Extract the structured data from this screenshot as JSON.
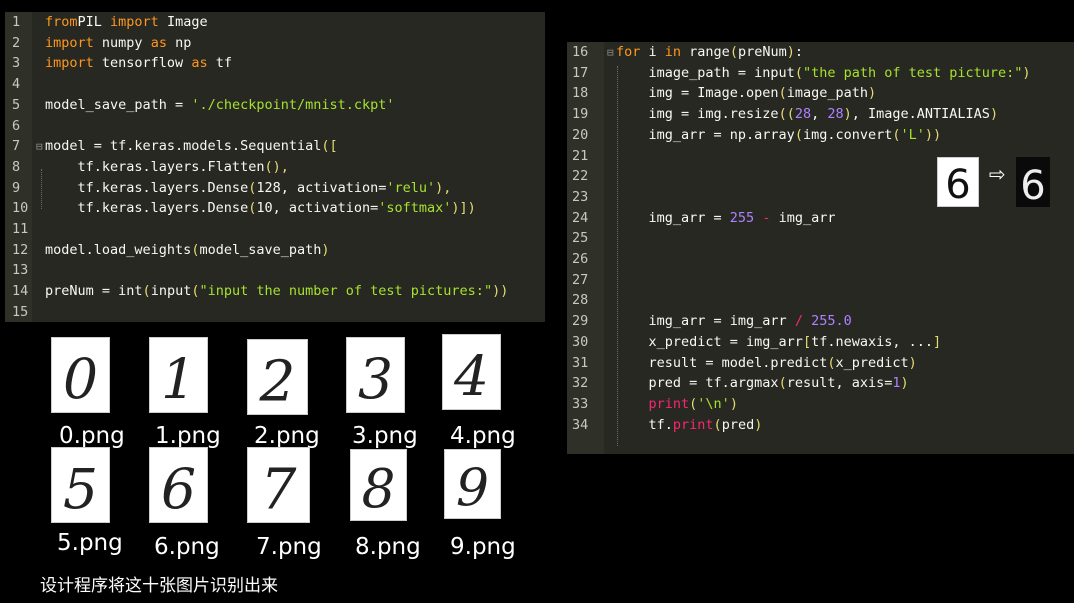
{
  "left_editor": {
    "lines": [
      {
        "n": "1",
        "parts": [
          [
            "kw2",
            "from"
          ],
          [
            "",
            "PIL "
          ],
          [
            "kw2",
            "import"
          ],
          [
            "",
            " Image"
          ]
        ]
      },
      {
        "n": "2",
        "parts": [
          [
            "kw2",
            "import"
          ],
          [
            "",
            " numpy "
          ],
          [
            "kw2",
            "as"
          ],
          [
            "",
            " np"
          ]
        ]
      },
      {
        "n": "3",
        "parts": [
          [
            "kw2",
            "import"
          ],
          [
            "",
            " tensorflow "
          ],
          [
            "kw2",
            "as"
          ],
          [
            "",
            " tf"
          ]
        ]
      },
      {
        "n": "4",
        "parts": []
      },
      {
        "n": "5",
        "parts": [
          [
            "",
            "model_save_path = "
          ],
          [
            "str",
            "'./checkpoint/mnist.ckpt'"
          ]
        ]
      },
      {
        "n": "6",
        "parts": []
      },
      {
        "n": "7",
        "parts": [
          [
            "",
            "model = tf.keras.models.Sequential"
          ],
          [
            "pn",
            "(["
          ]
        ]
      },
      {
        "n": "8",
        "parts": [
          [
            "",
            "    tf.keras.layers.Flatten"
          ],
          [
            "pn",
            "(),"
          ]
        ]
      },
      {
        "n": "9",
        "parts": [
          [
            "",
            "    tf.keras.layers.Dense"
          ],
          [
            "pn",
            "("
          ],
          [
            "",
            "128, activation="
          ],
          [
            "str",
            "'relu'"
          ],
          [
            "pn",
            "),"
          ]
        ]
      },
      {
        "n": "10",
        "parts": [
          [
            "",
            "    tf.keras.layers.Dense"
          ],
          [
            "pn",
            "("
          ],
          [
            "",
            "10, activation="
          ],
          [
            "str",
            "'softmax'"
          ],
          [
            "pn",
            ")])"
          ]
        ]
      },
      {
        "n": "11",
        "parts": []
      },
      {
        "n": "12",
        "parts": [
          [
            "",
            "model.load_weights"
          ],
          [
            "pn",
            "("
          ],
          [
            "",
            "model_save_path"
          ],
          [
            "pn",
            ")"
          ]
        ]
      },
      {
        "n": "13",
        "parts": []
      },
      {
        "n": "14",
        "parts": [
          [
            "",
            "preNum = int"
          ],
          [
            "pn",
            "("
          ],
          [
            "",
            "input"
          ],
          [
            "pn",
            "("
          ],
          [
            "str",
            "\"input the number of test pictures:\""
          ],
          [
            "pn",
            "))"
          ]
        ]
      },
      {
        "n": "15",
        "parts": []
      }
    ]
  },
  "right_editor": {
    "lines": [
      {
        "n": "16",
        "parts": [
          [
            "kw2",
            "for"
          ],
          [
            "",
            " i "
          ],
          [
            "kw2",
            "in"
          ],
          [
            "",
            " range"
          ],
          [
            "pn",
            "("
          ],
          [
            "",
            "preNum"
          ],
          [
            "pn",
            ")"
          ],
          [
            "",
            ":"
          ]
        ]
      },
      {
        "n": "17",
        "parts": [
          [
            "",
            "    image_path = input"
          ],
          [
            "pn",
            "("
          ],
          [
            "str",
            "\"the path of test picture:\""
          ],
          [
            "pn",
            ")"
          ]
        ]
      },
      {
        "n": "18",
        "parts": [
          [
            "",
            "    img = Image.open"
          ],
          [
            "pn",
            "("
          ],
          [
            "",
            "image_path"
          ],
          [
            "pn",
            ")"
          ]
        ]
      },
      {
        "n": "19",
        "parts": [
          [
            "",
            "    img = img.resize"
          ],
          [
            "pn",
            "(("
          ],
          [
            "num",
            "28"
          ],
          [
            "",
            ", "
          ],
          [
            "num",
            "28"
          ],
          [
            "pn",
            ")"
          ],
          [
            "",
            ", Image.ANTIALIAS"
          ],
          [
            "pn",
            ")"
          ]
        ]
      },
      {
        "n": "20",
        "parts": [
          [
            "",
            "    img_arr = np.array"
          ],
          [
            "pn",
            "("
          ],
          [
            "",
            "img.convert"
          ],
          [
            "pn",
            "("
          ],
          [
            "str",
            "'L'"
          ],
          [
            "pn",
            "))"
          ]
        ]
      },
      {
        "n": "21",
        "parts": []
      },
      {
        "n": "22",
        "parts": []
      },
      {
        "n": "23",
        "parts": []
      },
      {
        "n": "24",
        "parts": [
          [
            "",
            "    img_arr = "
          ],
          [
            "num",
            "255"
          ],
          [
            "kw",
            " - "
          ],
          [
            "",
            "img_arr"
          ]
        ]
      },
      {
        "n": "25",
        "parts": []
      },
      {
        "n": "26",
        "parts": []
      },
      {
        "n": "27",
        "parts": []
      },
      {
        "n": "28",
        "parts": []
      },
      {
        "n": "29",
        "parts": [
          [
            "",
            "    img_arr = img_arr "
          ],
          [
            "kw",
            "/"
          ],
          [
            "",
            " "
          ],
          [
            "num",
            "255.0"
          ]
        ]
      },
      {
        "n": "30",
        "parts": [
          [
            "",
            "    x_predict = img_arr"
          ],
          [
            "pn",
            "["
          ],
          [
            "",
            "tf.newaxis, ..."
          ],
          [
            "pn",
            "]"
          ]
        ]
      },
      {
        "n": "31",
        "parts": [
          [
            "",
            "    result = model.predict"
          ],
          [
            "pn",
            "("
          ],
          [
            "",
            "x_predict"
          ],
          [
            "pn",
            ")"
          ]
        ]
      },
      {
        "n": "32",
        "parts": [
          [
            "",
            "    pred = tf.argmax"
          ],
          [
            "pn",
            "("
          ],
          [
            "",
            "result, axis="
          ],
          [
            "num",
            "1"
          ],
          [
            "pn",
            ")"
          ]
        ]
      },
      {
        "n": "33",
        "parts": [
          [
            "kw",
            "    print"
          ],
          [
            "pn",
            "("
          ],
          [
            "str",
            "'\\n'"
          ],
          [
            "pn",
            ")"
          ]
        ]
      },
      {
        "n": "34",
        "parts": [
          [
            "",
            "    tf."
          ],
          [
            "kw",
            "print"
          ],
          [
            "pn",
            "("
          ],
          [
            "",
            "pred"
          ],
          [
            "pn",
            ")"
          ]
        ]
      }
    ]
  },
  "images": [
    {
      "file": "0.png",
      "digit": "0"
    },
    {
      "file": "1.png",
      "digit": "1"
    },
    {
      "file": "2.png",
      "digit": "2"
    },
    {
      "file": "3.png",
      "digit": "3"
    },
    {
      "file": "4.png",
      "digit": "4"
    },
    {
      "file": "5.png",
      "digit": "5"
    },
    {
      "file": "6.png",
      "digit": "6"
    },
    {
      "file": "7.png",
      "digit": "7"
    },
    {
      "file": "8.png",
      "digit": "8"
    },
    {
      "file": "9.png",
      "digit": "9"
    }
  ],
  "inversion": {
    "arrow": "⇨",
    "from_digit": "6",
    "to_digit": "6"
  },
  "note": "设计程序将这十张图片识别出来"
}
